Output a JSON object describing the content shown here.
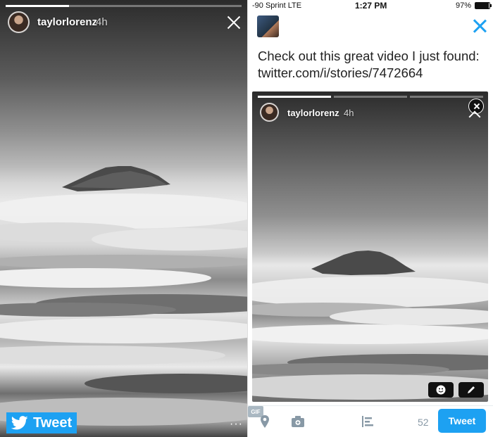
{
  "story_viewer": {
    "username": "taylorlorenz",
    "time_ago": "4h",
    "progress": 0.27,
    "tweet_badge_label": "Tweet",
    "more_label": "···"
  },
  "status_bar": {
    "carrier": "-90 Sprint  LTE",
    "time": "1:27 PM",
    "battery": "97%",
    "battery_level": 0.97
  },
  "compose": {
    "text": "Check out this great video I just found: twitter.com/i/stories/7472664",
    "card": {
      "username": "taylorlorenz",
      "time_ago": "4h",
      "progress_segments": [
        1.0,
        0.0,
        0.0
      ]
    }
  },
  "toolbar": {
    "char_count": "52",
    "gif_label": "GIF",
    "tweet_button_label": "Tweet"
  },
  "colors": {
    "accent": "#1da1f2",
    "icon_gray": "#8899a6"
  }
}
